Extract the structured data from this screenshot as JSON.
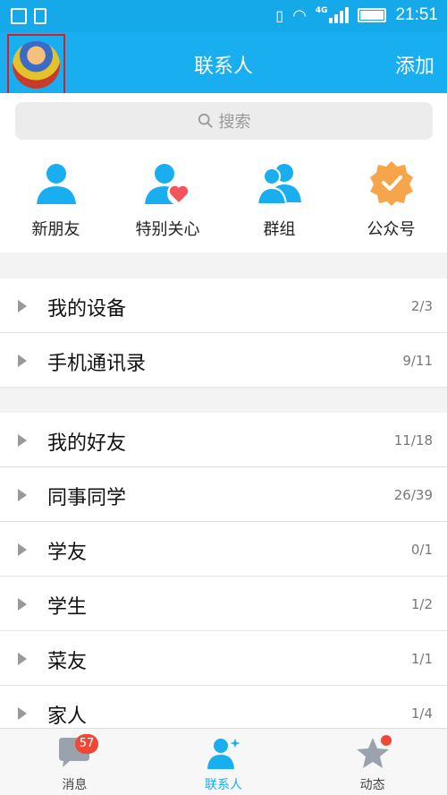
{
  "status_bar": {
    "time": "21:51",
    "network": "4G"
  },
  "header": {
    "title": "联系人",
    "add_label": "添加"
  },
  "search": {
    "placeholder": "搜索"
  },
  "quick_actions": [
    {
      "label": "新朋友",
      "icon": "person-icon"
    },
    {
      "label": "特别关心",
      "icon": "person-heart-icon"
    },
    {
      "label": "群组",
      "icon": "group-icon"
    },
    {
      "label": "公众号",
      "icon": "badge-check-icon"
    }
  ],
  "contact_groups_top": [
    {
      "name": "我的设备",
      "count": "2/3"
    },
    {
      "name": "手机通讯录",
      "count": "9/11"
    }
  ],
  "contact_groups": [
    {
      "name": "我的好友",
      "count": "11/18"
    },
    {
      "name": "同事同学",
      "count": "26/39"
    },
    {
      "name": "学友",
      "count": "0/1"
    },
    {
      "name": "学生",
      "count": "1/2"
    },
    {
      "name": "菜友",
      "count": "1/1"
    },
    {
      "name": "家人",
      "count": "1/4"
    }
  ],
  "tabbar": {
    "messages_label": "消息",
    "messages_badge": "57",
    "contacts_label": "联系人",
    "feed_label": "动态"
  },
  "colors": {
    "accent": "#19aef0",
    "badge": "#ef4836",
    "heart": "#f2565a",
    "badge_orange": "#f6a54a"
  }
}
